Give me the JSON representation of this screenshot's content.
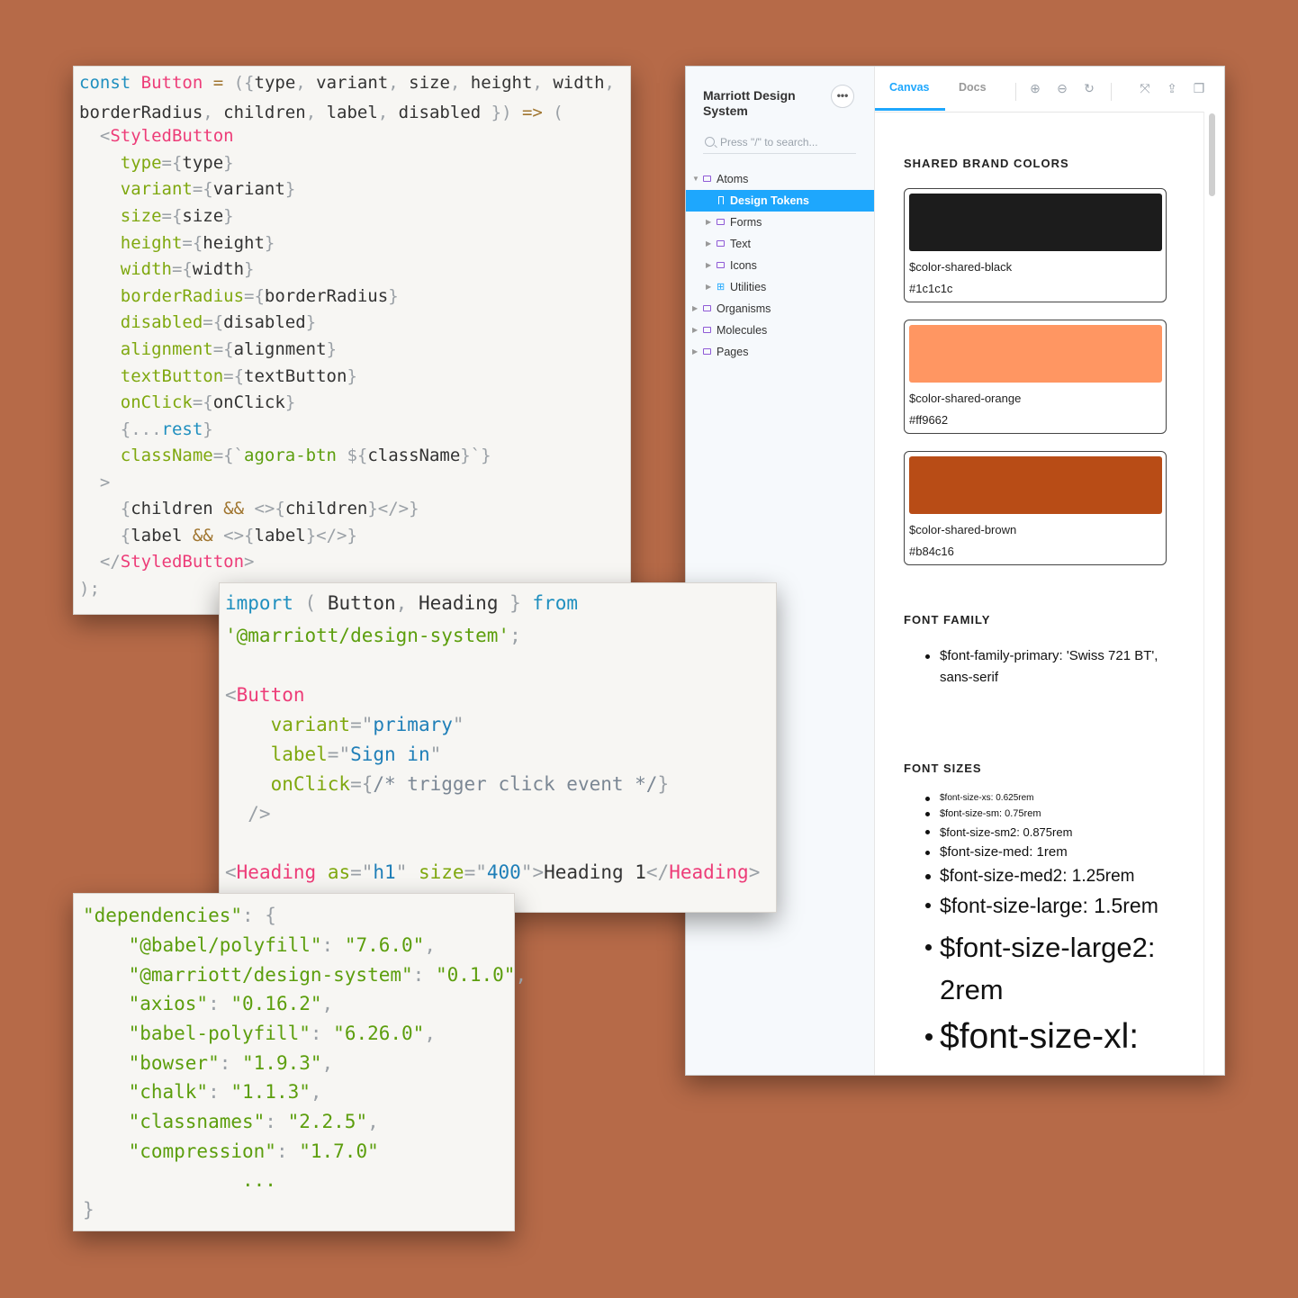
{
  "background_color": "#b66a48",
  "code_button": {
    "lines": [
      [
        [
          "kw",
          "const "
        ],
        [
          "fn",
          "Button "
        ],
        [
          "op",
          "= "
        ],
        [
          "punc",
          "({"
        ],
        [
          "txt",
          "type"
        ],
        [
          "punc",
          ", "
        ],
        [
          "txt",
          "variant"
        ],
        [
          "punc",
          ", "
        ],
        [
          "txt",
          "size"
        ],
        [
          "punc",
          ", "
        ],
        [
          "txt",
          "height"
        ],
        [
          "punc",
          ", "
        ],
        [
          "txt",
          "width"
        ],
        [
          "punc",
          ","
        ]
      ],
      [
        [
          "txt",
          "borderRadius"
        ],
        [
          "punc",
          ", "
        ],
        [
          "txt",
          "children"
        ],
        [
          "punc",
          ", "
        ],
        [
          "txt",
          "label"
        ],
        [
          "punc",
          ", "
        ],
        [
          "txt",
          "disabled "
        ],
        [
          "punc",
          "}) "
        ],
        [
          "op",
          "=> "
        ],
        [
          "punc",
          "("
        ]
      ],
      [
        [
          "punc",
          "  <"
        ],
        [
          "tag",
          "StyledButton"
        ]
      ],
      [
        [
          "attr",
          "    type"
        ],
        [
          "punc",
          "={"
        ],
        [
          "txt",
          "type"
        ],
        [
          "punc",
          "}"
        ]
      ],
      [
        [
          "attr",
          "    variant"
        ],
        [
          "punc",
          "={"
        ],
        [
          "txt",
          "variant"
        ],
        [
          "punc",
          "}"
        ]
      ],
      [
        [
          "attr",
          "    size"
        ],
        [
          "punc",
          "={"
        ],
        [
          "txt",
          "size"
        ],
        [
          "punc",
          "}"
        ]
      ],
      [
        [
          "attr",
          "    height"
        ],
        [
          "punc",
          "={"
        ],
        [
          "txt",
          "height"
        ],
        [
          "punc",
          "}"
        ]
      ],
      [
        [
          "attr",
          "    width"
        ],
        [
          "punc",
          "={"
        ],
        [
          "txt",
          "width"
        ],
        [
          "punc",
          "}"
        ]
      ],
      [
        [
          "attr",
          "    borderRadius"
        ],
        [
          "punc",
          "={"
        ],
        [
          "txt",
          "borderRadius"
        ],
        [
          "punc",
          "}"
        ]
      ],
      [
        [
          "attr",
          "    disabled"
        ],
        [
          "punc",
          "={"
        ],
        [
          "txt",
          "disabled"
        ],
        [
          "punc",
          "}"
        ]
      ],
      [
        [
          "attr",
          "    alignment"
        ],
        [
          "punc",
          "={"
        ],
        [
          "txt",
          "alignment"
        ],
        [
          "punc",
          "}"
        ]
      ],
      [
        [
          "attr",
          "    textButton"
        ],
        [
          "punc",
          "={"
        ],
        [
          "txt",
          "textButton"
        ],
        [
          "punc",
          "}"
        ]
      ],
      [
        [
          "attr",
          "    onClick"
        ],
        [
          "punc",
          "={"
        ],
        [
          "txt",
          "onClick"
        ],
        [
          "punc",
          "}"
        ]
      ],
      [
        [
          "punc",
          "    {..."
        ],
        [
          "kw",
          "rest"
        ],
        [
          "punc",
          "}"
        ]
      ],
      [
        [
          "attr",
          "    className"
        ],
        [
          "punc",
          "={`"
        ],
        [
          "str",
          "agora-btn "
        ],
        [
          "punc",
          "${"
        ],
        [
          "txt",
          "className"
        ],
        [
          "punc",
          "}`}"
        ]
      ],
      [
        [
          "punc",
          "  >"
        ]
      ],
      [
        [
          "punc",
          "    {"
        ],
        [
          "txt",
          "children "
        ],
        [
          "op",
          "&& "
        ],
        [
          "punc",
          "<>{"
        ],
        [
          "txt",
          "children"
        ],
        [
          "punc",
          "}</>}"
        ]
      ],
      [
        [
          "punc",
          "    {"
        ],
        [
          "txt",
          "label "
        ],
        [
          "op",
          "&& "
        ],
        [
          "punc",
          "<>{"
        ],
        [
          "txt",
          "label"
        ],
        [
          "punc",
          "}</>}"
        ]
      ],
      [
        [
          "punc",
          "  </"
        ],
        [
          "tag",
          "StyledButton"
        ],
        [
          "punc",
          ">"
        ]
      ],
      [
        [
          "punc",
          ");"
        ]
      ]
    ]
  },
  "code_import": {
    "lines": [
      [
        [
          "kw",
          "import "
        ],
        [
          "punc",
          "( "
        ],
        [
          "txt",
          "Button"
        ],
        [
          "punc",
          ", "
        ],
        [
          "txt",
          "Heading "
        ],
        [
          "punc",
          "} "
        ],
        [
          "kw",
          "from"
        ]
      ],
      [
        [
          "str",
          "'@marriott/design-system'"
        ],
        [
          "punc",
          ";"
        ]
      ],
      [],
      [
        [
          "punc",
          "<"
        ],
        [
          "tag",
          "Button"
        ]
      ],
      [
        [
          "attr",
          "    variant"
        ],
        [
          "punc",
          "=\""
        ],
        [
          "val",
          "primary"
        ],
        [
          "punc",
          "\""
        ]
      ],
      [
        [
          "attr",
          "    label"
        ],
        [
          "punc",
          "=\""
        ],
        [
          "val",
          "Sign in"
        ],
        [
          "punc",
          "\""
        ]
      ],
      [
        [
          "attr",
          "    onClick"
        ],
        [
          "punc",
          "={"
        ],
        [
          "cmt",
          "/* trigger click event */"
        ],
        [
          "punc",
          "}"
        ]
      ],
      [
        [
          "punc",
          "  />"
        ]
      ],
      [],
      [
        [
          "punc",
          "<"
        ],
        [
          "tag",
          "Heading "
        ],
        [
          "attr",
          "as"
        ],
        [
          "punc",
          "=\""
        ],
        [
          "val",
          "h1"
        ],
        [
          "punc",
          "\" "
        ],
        [
          "attr",
          "size"
        ],
        [
          "punc",
          "=\""
        ],
        [
          "val",
          "400"
        ],
        [
          "punc",
          "\">"
        ],
        [
          "txt",
          "Heading 1"
        ],
        [
          "punc",
          "</"
        ],
        [
          "tag",
          "Heading"
        ],
        [
          "punc",
          ">"
        ]
      ]
    ]
  },
  "code_deps": {
    "lines": [
      [
        [
          "str",
          "\"dependencies\""
        ],
        [
          "punc",
          ": {"
        ]
      ],
      [
        [
          "str",
          "    \"@babel/polyfill\""
        ],
        [
          "punc",
          ": "
        ],
        [
          "str",
          "\"7.6.0\""
        ],
        [
          "punc",
          ","
        ]
      ],
      [
        [
          "str",
          "    \"@marriott/design-system\""
        ],
        [
          "punc",
          ": "
        ],
        [
          "str",
          "\"0.1.0\""
        ],
        [
          "punc",
          ","
        ]
      ],
      [
        [
          "str",
          "    \"axios\""
        ],
        [
          "punc",
          ": "
        ],
        [
          "str",
          "\"0.16.2\""
        ],
        [
          "punc",
          ","
        ]
      ],
      [
        [
          "str",
          "    \"babel-polyfill\""
        ],
        [
          "punc",
          ": "
        ],
        [
          "str",
          "\"6.26.0\""
        ],
        [
          "punc",
          ","
        ]
      ],
      [
        [
          "str",
          "    \"bowser\""
        ],
        [
          "punc",
          ": "
        ],
        [
          "str",
          "\"1.9.3\""
        ],
        [
          "punc",
          ","
        ]
      ],
      [
        [
          "str",
          "    \"chalk\""
        ],
        [
          "punc",
          ": "
        ],
        [
          "str",
          "\"1.1.3\""
        ],
        [
          "punc",
          ","
        ]
      ],
      [
        [
          "str",
          "    \"classnames\""
        ],
        [
          "punc",
          ": "
        ],
        [
          "str",
          "\"2.2.5\""
        ],
        [
          "punc",
          ","
        ]
      ],
      [
        [
          "str",
          "    \"compression\""
        ],
        [
          "punc",
          ": "
        ],
        [
          "str",
          "\"1.7.0\""
        ]
      ],
      [
        [
          "str",
          "              ..."
        ]
      ],
      [
        [
          "punc",
          "}"
        ]
      ]
    ]
  },
  "storybook": {
    "title": "Marriott Design System",
    "menu_label": "•••",
    "search_placeholder": "Press \"/\" to search...",
    "tabs": [
      {
        "label": "Canvas",
        "active": true
      },
      {
        "label": "Docs",
        "active": false
      }
    ],
    "tree": [
      {
        "label": "Atoms",
        "depth": 0,
        "expanded": true,
        "icon": "folder-icon"
      },
      {
        "label": "Design Tokens",
        "depth": 1,
        "active": true,
        "icon": "bookmark-icon"
      },
      {
        "label": "Forms",
        "depth": 1,
        "icon": "folder-icon"
      },
      {
        "label": "Text",
        "depth": 1,
        "icon": "folder-icon"
      },
      {
        "label": "Icons",
        "depth": 1,
        "icon": "folder-icon"
      },
      {
        "label": "Utilities",
        "depth": 1,
        "icon": "component-icon"
      },
      {
        "label": "Organisms",
        "depth": 0,
        "icon": "folder-icon"
      },
      {
        "label": "Molecules",
        "depth": 0,
        "icon": "folder-icon"
      },
      {
        "label": "Pages",
        "depth": 0,
        "icon": "folder-icon"
      }
    ],
    "shared_brand_colors": {
      "title": "SHARED BRAND COLORS",
      "swatches": [
        {
          "name": "$color-shared-black",
          "hex": "#1c1c1c"
        },
        {
          "name": "$color-shared-orange",
          "hex": "#ff9662"
        },
        {
          "name": "$color-shared-brown",
          "hex": "#b84c16"
        }
      ]
    },
    "font_family": {
      "title": "FONT FAMILY",
      "items": [
        "$font-family-primary: 'Swiss 721 BT', sans-serif"
      ]
    },
    "font_sizes": {
      "title": "FONT SIZES",
      "items": [
        "$font-size-xs: 0.625rem",
        "$font-size-sm: 0.75rem",
        "$font-size-sm2: 0.875rem",
        "$font-size-med: 1rem",
        "$font-size-med2: 1.25rem",
        "$font-size-large: 1.5rem",
        "$font-size-large2: 2rem",
        "$font-size-xl:"
      ]
    }
  }
}
